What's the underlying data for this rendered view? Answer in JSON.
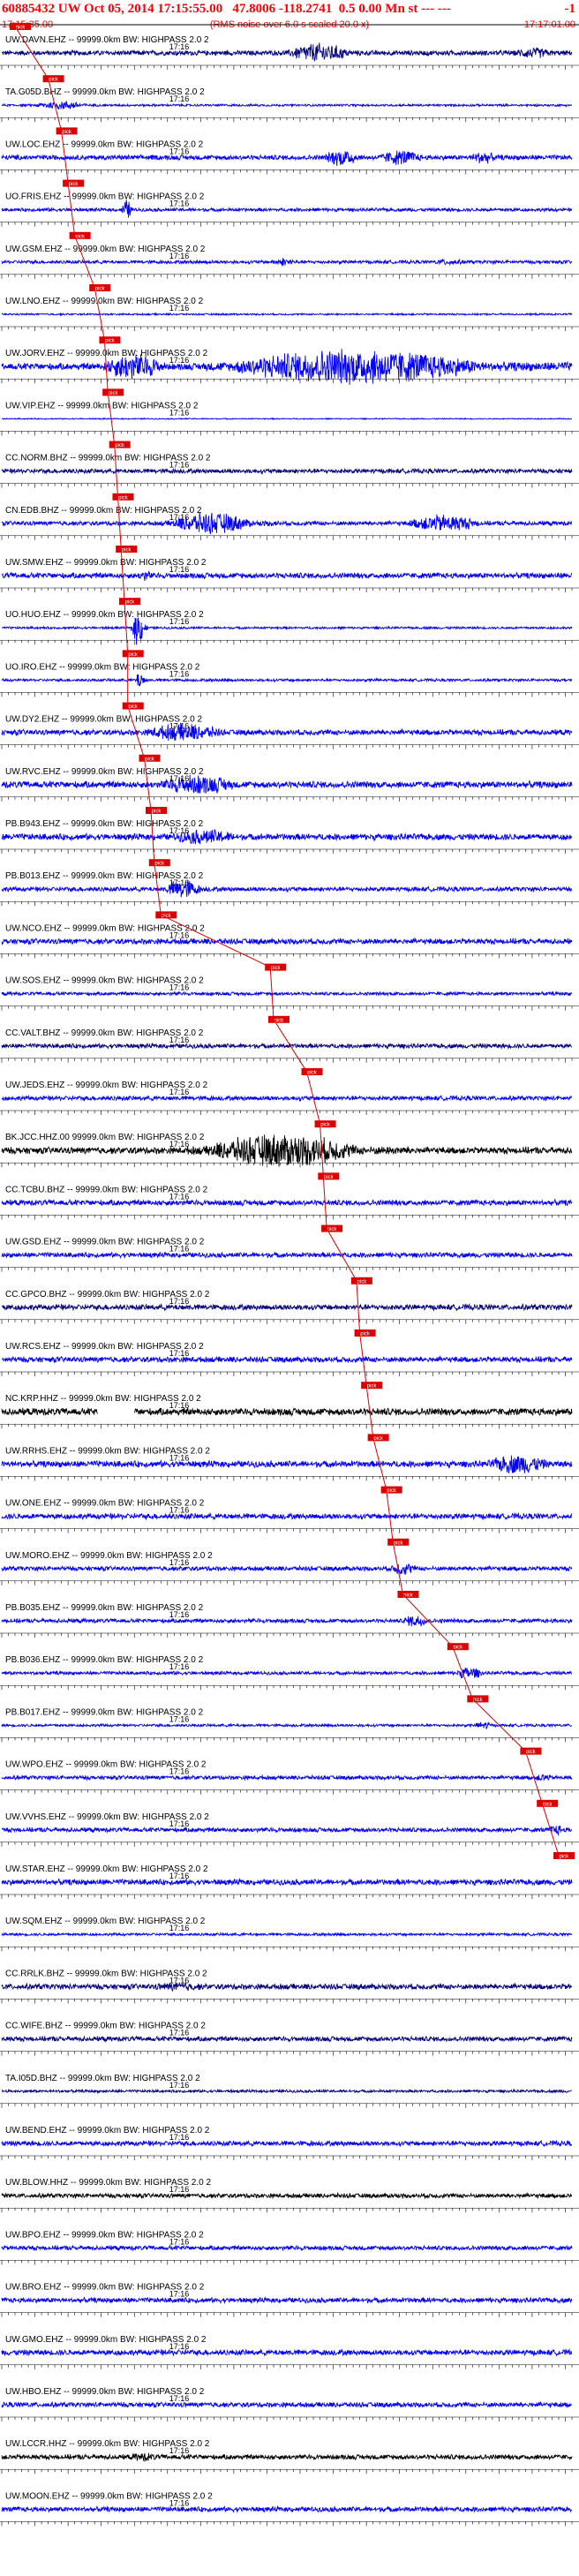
{
  "header": {
    "title": "60885432 UW Oct 05, 2014 17:15:55.00   47.8006 -118.2741  0.5 0.00 Mn st --- ---",
    "tag": "-1",
    "time_left": "17:15:35.00",
    "subtitle": "(RMS noise over 6.0 s scaled 20.0 x)",
    "time_right": "17:17:01.00"
  },
  "colors": {
    "axis": "#000000",
    "label": "#000000",
    "pick": "#dd0000",
    "pick_text": "#ffffff",
    "blue": "#0000ff",
    "navy": "#000080",
    "black": "#000000",
    "grid": "#000000"
  },
  "chart_data": {
    "type": "line",
    "title": "60885432 UW Oct 05, 2014 17:15:55.00   47.8006 -118.2741  0.5 0.00 Mn st --- ---",
    "subtitle": "(RMS noise over 6.0 s scaled 20.0 x)",
    "x_range_seconds": [
      0,
      86
    ],
    "x_start_time": "17:15:35.00",
    "x_end_time": "17:17:01.00",
    "tick_label": "17:16",
    "tick_label_second": 25,
    "pick_mark_text": "pick",
    "series": [
      {
        "name": "UW.DAVN.EHZ -- 99999.0km BW: HIGHPASS  2.0  2",
        "color": "navy",
        "pick_sec": 2.0,
        "noise": 0.22,
        "events": [
          [
            42,
            56,
            0.9
          ],
          [
            76,
            86,
            0.5
          ]
        ]
      },
      {
        "name": "TA.G05D.BHZ -- 99999.0km BW: HIGHPASS  2.0  2",
        "color": "blue",
        "pick_sec": 7.0,
        "noise": 0.1,
        "events": [
          [
            4,
            16,
            0.4
          ]
        ]
      },
      {
        "name": "UW.LOC.EHZ -- 99999.0km BW: HIGHPASS  2.0  2",
        "color": "blue",
        "pick_sec": 9.0,
        "noise": 0.22,
        "events": [
          [
            48,
            56,
            0.8
          ],
          [
            56,
            66,
            0.7
          ],
          [
            70,
            76,
            0.6
          ]
        ]
      },
      {
        "name": "UO.FRIS.EHZ -- 99999.0km BW: HIGHPASS  2.0  2",
        "color": "blue",
        "pick_sec": 10.0,
        "noise": 0.15,
        "events": [
          [
            18,
            20,
            1.0
          ]
        ]
      },
      {
        "name": "UW.GSM.EHZ -- 99999.0km BW: HIGHPASS  2.0  2",
        "color": "blue",
        "pick_sec": 11.0,
        "noise": 0.15,
        "events": [
          [
            40,
            46,
            0.4
          ],
          [
            64,
            72,
            0.3
          ]
        ]
      },
      {
        "name": "UW.LNO.EHZ -- 99999.0km BW: HIGHPASS  2.0  2",
        "color": "blue",
        "pick_sec": 14.0,
        "noise": 0.08,
        "events": []
      },
      {
        "name": "UW.JORV.EHZ -- 99999.0km BW: HIGHPASS  2.0  2",
        "color": "blue",
        "pick_sec": 15.5,
        "noise": 0.3,
        "events": [
          [
            14,
            28,
            1.2
          ],
          [
            30,
            86,
            1.6
          ]
        ]
      },
      {
        "name": "UW.VIP.EHZ -- 99999.0km BW: HIGHPASS  2.0  2",
        "color": "blue",
        "pick_sec": 16.0,
        "noise": 0.05,
        "events": []
      },
      {
        "name": "CC.NORM.BHZ -- 99999.0km BW: HIGHPASS  2.0  2",
        "color": "navy",
        "pick_sec": 17.0,
        "noise": 0.2,
        "events": []
      },
      {
        "name": "CN.EDB.BHZ -- 99999.0km BW: HIGHPASS  2.0  2",
        "color": "blue",
        "pick_sec": 17.5,
        "noise": 0.2,
        "events": [
          [
            24,
            42,
            1.0
          ],
          [
            60,
            76,
            0.8
          ]
        ]
      },
      {
        "name": "UW.SMW.EHZ -- 99999.0km BW: HIGHPASS  2.0  2",
        "color": "blue",
        "pick_sec": 18.0,
        "noise": 0.25,
        "events": [
          [
            20,
            24,
            0.5
          ]
        ]
      },
      {
        "name": "UO.HUO.EHZ -- 99999.0km BW: HIGHPASS  2.0  2",
        "color": "blue",
        "pick_sec": 18.5,
        "noise": 0.1,
        "events": [
          [
            19.5,
            22,
            1.6
          ]
        ]
      },
      {
        "name": "UO.IRO.EHZ -- 99999.0km BW: HIGHPASS  2.0  2",
        "color": "blue",
        "pick_sec": 19.0,
        "noise": 0.12,
        "events": [
          [
            20,
            22,
            0.8
          ]
        ]
      },
      {
        "name": "UW.DY2.EHZ -- 99999.0km BW: HIGHPASS  2.0  2",
        "color": "blue",
        "pick_sec": 19.0,
        "noise": 0.25,
        "events": [
          [
            20,
            38,
            0.8
          ]
        ]
      },
      {
        "name": "UW.RVC.EHZ -- 99999.0km BW: HIGHPASS  2.0  2",
        "color": "blue",
        "pick_sec": 21.5,
        "noise": 0.3,
        "events": [
          [
            22,
            40,
            0.9
          ]
        ]
      },
      {
        "name": "PB.B943.EHZ -- 99999.0km BW: HIGHPASS  2.0  2",
        "color": "blue",
        "pick_sec": 22.5,
        "noise": 0.28,
        "events": [
          [
            24,
            40,
            0.7
          ]
        ]
      },
      {
        "name": "PB.B013.EHZ -- 99999.0km BW: HIGHPASS  2.0  2",
        "color": "blue",
        "pick_sec": 23.0,
        "noise": 0.2,
        "events": [
          [
            24,
            32,
            0.9
          ]
        ]
      },
      {
        "name": "UW.NCO.EHZ -- 99999.0km BW: HIGHPASS  2.0  2",
        "color": "blue",
        "pick_sec": 24.0,
        "noise": 0.25,
        "events": []
      },
      {
        "name": "UW.SOS.EHZ -- 99999.0km BW: HIGHPASS  2.0  2",
        "color": "blue",
        "pick_sec": 40.5,
        "noise": 0.15,
        "events": []
      },
      {
        "name": "CC.VALT.BHZ -- 99999.0km BW: HIGHPASS  2.0  2",
        "color": "navy",
        "pick_sec": 41.0,
        "noise": 0.2,
        "events": []
      },
      {
        "name": "UW.JEDS.EHZ -- 99999.0km BW: HIGHPASS  2.0  2",
        "color": "blue",
        "pick_sec": 46.0,
        "noise": 0.2,
        "events": []
      },
      {
        "name": "BK.JCC.HHZ.00 99999.0km BW: HIGHPASS  2.0  2",
        "color": "black",
        "pick_sec": 48.0,
        "noise": 0.3,
        "events": [
          [
            28,
            62,
            1.5
          ]
        ]
      },
      {
        "name": "CC.TCBU.BHZ -- 99999.0km BW: HIGHPASS  2.0  2",
        "color": "blue",
        "pick_sec": 48.5,
        "noise": 0.25,
        "events": []
      },
      {
        "name": "UW.GSD.EHZ -- 99999.0km BW: HIGHPASS  2.0  2",
        "color": "blue",
        "pick_sec": 49.0,
        "noise": 0.22,
        "events": []
      },
      {
        "name": "CC.GPCO.BHZ -- 99999.0km BW: HIGHPASS  2.0  2",
        "color": "navy",
        "pick_sec": 53.5,
        "noise": 0.25,
        "events": []
      },
      {
        "name": "UW.RCS.EHZ -- 99999.0km BW: HIGHPASS  2.0  2",
        "color": "blue",
        "pick_sec": 54.0,
        "noise": 0.25,
        "events": []
      },
      {
        "name": "NC.KRP.HHZ -- 99999.0km BW: HIGHPASS  2.0  2",
        "color": "black",
        "pick_sec": 55.0,
        "noise": 0.32,
        "gap": [
          14.5,
          20
        ],
        "events": []
      },
      {
        "name": "UW.RRHS.EHZ -- 99999.0km BW: HIGHPASS  2.0  2",
        "color": "blue",
        "pick_sec": 56.0,
        "noise": 0.28,
        "events": [
          [
            72,
            86,
            0.9
          ]
        ]
      },
      {
        "name": "UW.ONE.EHZ -- 99999.0km BW: HIGHPASS  2.0  2",
        "color": "blue",
        "pick_sec": 58.0,
        "noise": 0.25,
        "events": []
      },
      {
        "name": "UW.MORO.EHZ -- 99999.0km BW: HIGHPASS  2.0  2",
        "color": "blue",
        "pick_sec": 59.0,
        "noise": 0.2,
        "events": [
          [
            58,
            64,
            0.6
          ]
        ]
      },
      {
        "name": "PB.B035.EHZ -- 99999.0km BW: HIGHPASS  2.0  2",
        "color": "blue",
        "pick_sec": 60.5,
        "noise": 0.18,
        "events": [
          [
            60,
            66,
            0.6
          ]
        ]
      },
      {
        "name": "PB.B036.EHZ -- 99999.0km BW: HIGHPASS  2.0  2",
        "color": "blue",
        "pick_sec": 68.0,
        "noise": 0.15,
        "events": [
          [
            68,
            74,
            0.6
          ]
        ]
      },
      {
        "name": "PB.B017.EHZ -- 99999.0km BW: HIGHPASS  2.0  2",
        "color": "blue",
        "pick_sec": 71.0,
        "noise": 0.12,
        "events": [
          [
            71,
            75,
            0.4
          ]
        ]
      },
      {
        "name": "UW.WPO.EHZ -- 99999.0km BW: HIGHPASS  2.0  2",
        "color": "blue",
        "pick_sec": 79.0,
        "noise": 0.18,
        "events": [
          [
            80,
            84,
            0.4
          ]
        ]
      },
      {
        "name": "UW.VVHS.EHZ -- 99999.0km BW: HIGHPASS  2.0  2",
        "color": "blue",
        "pick_sec": 81.5,
        "noise": 0.2,
        "events": [
          [
            82,
            86,
            0.5
          ]
        ]
      },
      {
        "name": "UW.STAR.EHZ -- 99999.0km BW: HIGHPASS  2.0  2",
        "color": "blue",
        "pick_sec": 84.0,
        "noise": 0.25,
        "events": []
      },
      {
        "name": "UW.SQM.EHZ -- 99999.0km BW: HIGHPASS  2.0  2",
        "color": "blue",
        "pick_sec": null,
        "noise": 0.12,
        "events": []
      },
      {
        "name": "CC.RRLK.BHZ -- 99999.0km BW: HIGHPASS  2.0  2",
        "color": "navy",
        "pick_sec": null,
        "noise": 0.25,
        "events": [
          [
            20,
            36,
            0.4
          ]
        ]
      },
      {
        "name": "CC.WIFE.BHZ -- 99999.0km BW: HIGHPASS  2.0  2",
        "color": "navy",
        "pick_sec": null,
        "noise": 0.22,
        "events": []
      },
      {
        "name": "TA.I05D.BHZ -- 99999.0km BW: HIGHPASS  2.0  2",
        "color": "navy",
        "pick_sec": null,
        "noise": 0.12,
        "events": []
      },
      {
        "name": "UW.BEND.EHZ -- 99999.0km BW: HIGHPASS  2.0  2",
        "color": "blue",
        "pick_sec": null,
        "noise": 0.22,
        "events": []
      },
      {
        "name": "UW.BLOW.HHZ -- 99999.0km BW: HIGHPASS  2.0  2",
        "color": "black",
        "pick_sec": null,
        "noise": 0.2,
        "events": []
      },
      {
        "name": "UW.BPO.EHZ -- 99999.0km BW: HIGHPASS  2.0  2",
        "color": "blue",
        "pick_sec": null,
        "noise": 0.2,
        "events": []
      },
      {
        "name": "UW.BRO.EHZ -- 99999.0km BW: HIGHPASS  2.0  2",
        "color": "blue",
        "pick_sec": null,
        "noise": 0.22,
        "events": []
      },
      {
        "name": "UW.GMO.EHZ -- 99999.0km BW: HIGHPASS  2.0  2",
        "color": "blue",
        "pick_sec": null,
        "noise": 0.25,
        "events": []
      },
      {
        "name": "UW.HBO.EHZ -- 99999.0km BW: HIGHPASS  2.0  2",
        "color": "blue",
        "pick_sec": null,
        "noise": 0.22,
        "events": []
      },
      {
        "name": "UW.LCCR.HHZ -- 99999.0km BW: HIGHPASS  2.0  2",
        "color": "black",
        "pick_sec": null,
        "noise": 0.22,
        "events": [
          [
            18,
            26,
            0.4
          ]
        ]
      },
      {
        "name": "UW.MOON.EHZ -- 99999.0km BW: HIGHPASS  2.0  2",
        "color": "blue",
        "pick_sec": null,
        "noise": 0.22,
        "events": []
      }
    ]
  }
}
